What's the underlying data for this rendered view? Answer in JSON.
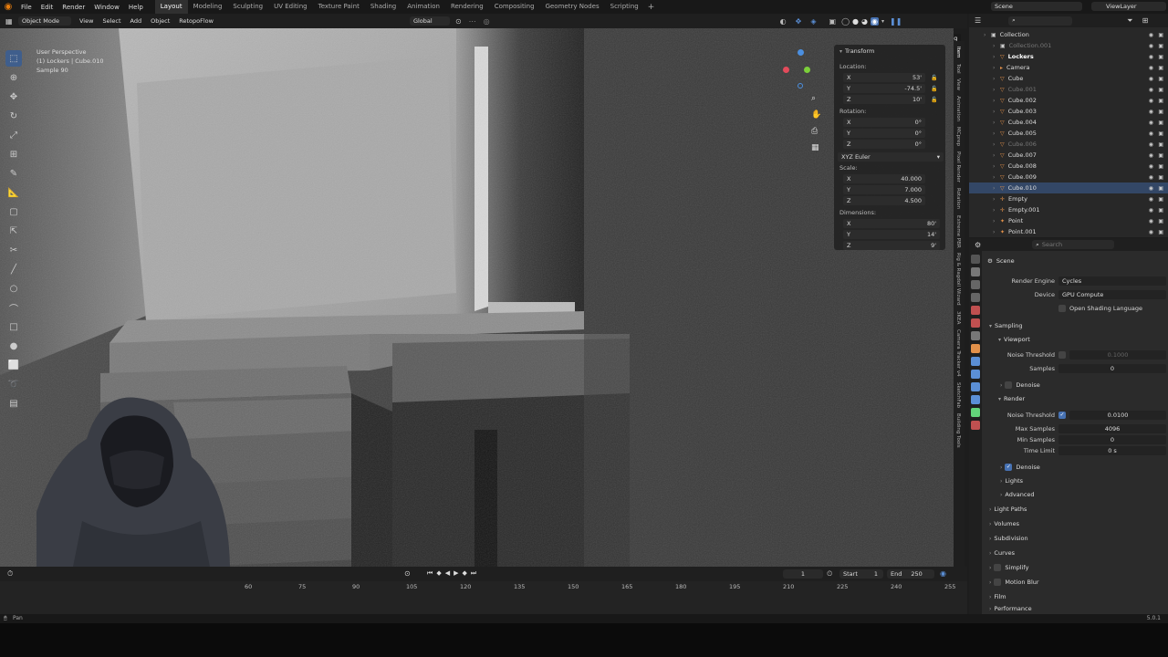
{
  "topbar": {
    "menus": [
      "File",
      "Edit",
      "Render",
      "Window",
      "Help"
    ],
    "workspaces": [
      "Layout",
      "Modeling",
      "Sculpting",
      "UV Editing",
      "Texture Paint",
      "Shading",
      "Animation",
      "Rendering",
      "Compositing",
      "Geometry Nodes",
      "Scripting"
    ],
    "active_workspace": "Layout",
    "scene": "Scene",
    "view_layer": "ViewLayer"
  },
  "viewport_header": {
    "mode": "Object Mode",
    "menus": [
      "View",
      "Select",
      "Add",
      "Object",
      "RetopoFlow"
    ],
    "orientation": "Global",
    "shading_tooltip": "Shading"
  },
  "overlay": {
    "line1": "User Perspective",
    "line2": "(1) Lockers | Cube.010",
    "line3": "Sample 90"
  },
  "npanel": {
    "title": "Transform",
    "location_label": "Location:",
    "location": {
      "x": "53'",
      "y": "-74.5'",
      "z": "10'"
    },
    "rotation_label": "Rotation:",
    "rotation": {
      "x": "0°",
      "y": "0°",
      "z": "0°"
    },
    "rotation_mode": "XYZ Euler",
    "scale_label": "Scale:",
    "scale": {
      "x": "40.000",
      "y": "7.000",
      "z": "4.500"
    },
    "dimensions_label": "Dimensions:",
    "dimensions": {
      "x": "80'",
      "y": "14'",
      "z": "9'"
    },
    "axis": {
      "x": "X",
      "y": "Y",
      "z": "Z"
    }
  },
  "vertical_tabs": [
    "Item",
    "Tool",
    "View",
    "Animation",
    "MCprep",
    "Pixel Render",
    "Rotation",
    "Extreme PBR",
    "Rig & Ragdoll Wizard",
    "3KEA",
    "Camera Tracker v4",
    "SketchFab",
    "Building Tools"
  ],
  "outliner": {
    "search_placeholder": "",
    "items": [
      {
        "name": "Collection",
        "indent": 0,
        "dim": false
      },
      {
        "name": "Collection.001",
        "indent": 1,
        "dim": true
      },
      {
        "name": "Lockers",
        "indent": 1,
        "dim": false
      },
      {
        "name": "Camera",
        "indent": 1,
        "dim": false
      },
      {
        "name": "Cube",
        "indent": 1,
        "dim": false
      },
      {
        "name": "Cube.001",
        "indent": 1,
        "dim": true
      },
      {
        "name": "Cube.002",
        "indent": 1,
        "dim": false
      },
      {
        "name": "Cube.003",
        "indent": 1,
        "dim": false
      },
      {
        "name": "Cube.004",
        "indent": 1,
        "dim": false
      },
      {
        "name": "Cube.005",
        "indent": 1,
        "dim": false
      },
      {
        "name": "Cube.006",
        "indent": 1,
        "dim": true
      },
      {
        "name": "Cube.007",
        "indent": 1,
        "dim": false
      },
      {
        "name": "Cube.008",
        "indent": 1,
        "dim": false
      },
      {
        "name": "Cube.009",
        "indent": 1,
        "dim": false
      },
      {
        "name": "Cube.010",
        "indent": 1,
        "dim": false
      },
      {
        "name": "Empty",
        "indent": 1,
        "dim": false
      },
      {
        "name": "Empty.001",
        "indent": 1,
        "dim": false
      },
      {
        "name": "Point",
        "indent": 1,
        "dim": false
      },
      {
        "name": "Point.001",
        "indent": 1,
        "dim": false
      }
    ]
  },
  "properties": {
    "search_placeholder": "Search",
    "context": "Scene",
    "render_engine_label": "Render Engine",
    "render_engine": "Cycles",
    "device_label": "Device",
    "device": "GPU Compute",
    "osl_label": "Open Shading Language",
    "sampling": "Sampling",
    "viewport": "Viewport",
    "vp_noise_threshold_label": "Noise Threshold",
    "vp_noise_threshold": "0.1000",
    "vp_samples_label": "Samples",
    "vp_samples": "0",
    "denoise": "Denoise",
    "render": "Render",
    "r_noise_threshold_label": "Noise Threshold",
    "r_noise_threshold": "0.0100",
    "max_samples_label": "Max Samples",
    "max_samples": "4096",
    "min_samples_label": "Min Samples",
    "min_samples": "0",
    "time_limit_label": "Time Limit",
    "time_limit": "0 s",
    "denoise2": "Denoise",
    "lights": "Lights",
    "advanced": "Advanced",
    "light_paths": "Light Paths",
    "volumes": "Volumes",
    "subdivision": "Subdivision",
    "curves": "Curves",
    "simplify": "Simplify",
    "motion_blur": "Motion Blur",
    "film": "Film",
    "performance": "Performance"
  },
  "timeline": {
    "current_frame": "1",
    "start_label": "Start",
    "start": "1",
    "end_label": "End",
    "end": "250",
    "ruler": [
      "60",
      "75",
      "90",
      "105",
      "120",
      "135",
      "150",
      "165",
      "180",
      "195",
      "210",
      "225",
      "240",
      "255"
    ]
  },
  "status": {
    "left": "Pan",
    "version": "5.0.1"
  },
  "colors": {
    "accent_blue": "#4772b3",
    "object_orange": "#e3914a",
    "mesh_green": "#62d47a"
  }
}
